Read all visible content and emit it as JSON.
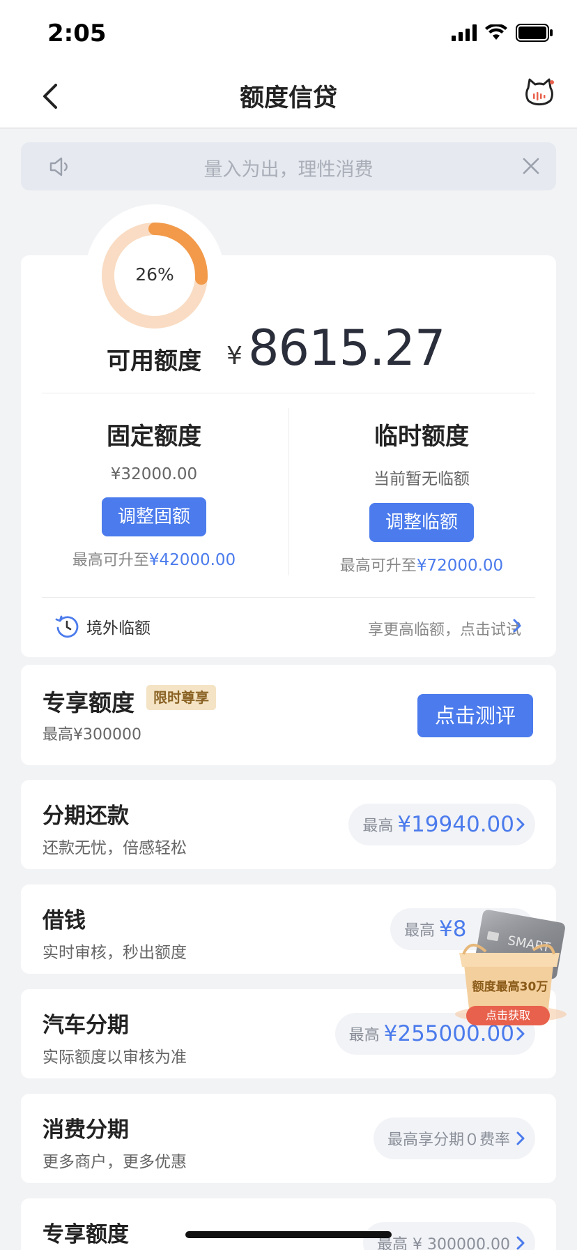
{
  "status_bar": {
    "time": "2:05"
  },
  "nav": {
    "title": "额度信贷"
  },
  "notice": {
    "text": "量入为出，理性消费"
  },
  "quota": {
    "usage_percent_label": "26%",
    "usage_fraction": 0.26,
    "available_label": "可用额度",
    "currency": "¥",
    "available_amount": "8615.27",
    "fixed": {
      "title": "固定额度",
      "value": "¥32000.00",
      "button": "调整固额",
      "max_prefix": "最高可升至",
      "max_value": "¥42000.00"
    },
    "temporary": {
      "title": "临时额度",
      "value": "当前暂无临额",
      "button": "调整临额",
      "max_prefix": "最高可升至",
      "max_value": "¥72000.00"
    },
    "overseas": {
      "label": "境外临额",
      "hint": "享更高临额，点击试试"
    }
  },
  "exclusive": {
    "title": "专享额度",
    "badge": "限时尊享",
    "subtitle": "最高¥300000",
    "button": "点击测评"
  },
  "list": [
    {
      "title": "分期还款",
      "subtitle": "还款无忧，倍感轻松",
      "pill_prefix": "最高",
      "pill_amount": "¥19940.00"
    },
    {
      "title": "借钱",
      "subtitle": "实时审核，秒出额度",
      "pill_prefix": "最高",
      "pill_amount": "¥8"
    },
    {
      "title": "汽车分期",
      "subtitle": "实际额度以审核为准",
      "pill_prefix": "最高",
      "pill_amount": "¥255000.00"
    },
    {
      "title": "消费分期",
      "subtitle": "更多商户，更多优惠",
      "pill_prefix": "最高享分期０费率",
      "pill_amount": ""
    },
    {
      "title": "专享额度",
      "subtitle": "",
      "pill_prefix": "最高 ¥ 300000.00",
      "pill_amount": ""
    }
  ],
  "promo": {
    "card_text": "SMART",
    "text": "额度最高30万",
    "button": "点击获取"
  },
  "colors": {
    "accent": "#4b7bec",
    "ring": "#f29a4a",
    "ring_track": "#f9dcc3"
  }
}
